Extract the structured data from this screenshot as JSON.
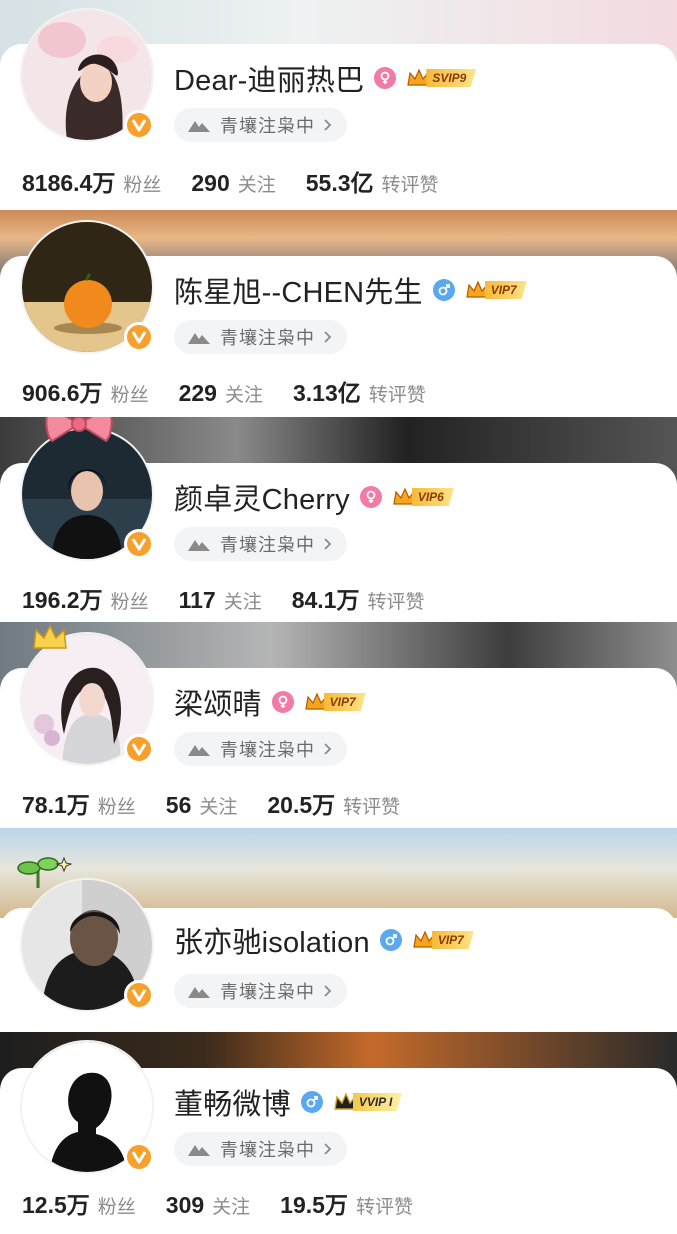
{
  "profiles": [
    {
      "name": "Dear-迪丽热巴",
      "gender": "female",
      "vip_label": "SVIP9",
      "vip_style": "gold",
      "tag": "青壤注枭中",
      "avatar_icon": "woman-portrait",
      "banner_colors": [
        "#dfe6e9",
        "#f1d8de"
      ],
      "stats": {
        "fans": "8186.4万",
        "fans_label": "粉丝",
        "follow": "290",
        "follow_label": "关注",
        "likes": "55.3亿",
        "likes_label": "转评赞"
      }
    },
    {
      "name": "陈星旭--CHEN先生",
      "gender": "male",
      "vip_label": "VIP7",
      "vip_style": "gold",
      "tag": "青壤注枭中",
      "avatar_icon": "orange-fruit",
      "banner_colors": [
        "#c7784a",
        "#3c4a5e"
      ],
      "stats": {
        "fans": "906.6万",
        "fans_label": "粉丝",
        "follow": "229",
        "follow_label": "关注",
        "likes": "3.13亿",
        "likes_label": "转评赞"
      }
    },
    {
      "name": "颜卓灵Cherry",
      "gender": "female",
      "vip_label": "VIP6",
      "vip_style": "gold",
      "tag": "青壤注枭中",
      "avatar_icon": "woman-portrait-bow",
      "banner_colors": [
        "#2a2a2a",
        "#6d6d6d"
      ],
      "stats": {
        "fans": "196.2万",
        "fans_label": "粉丝",
        "follow": "117",
        "follow_label": "关注",
        "likes": "84.1万",
        "likes_label": "转评赞"
      }
    },
    {
      "name": "梁颂晴",
      "gender": "female",
      "vip_label": "VIP7",
      "vip_style": "gold",
      "tag": "青壤注枭中",
      "avatar_icon": "illustrated-woman",
      "banner_colors": [
        "#8d8d8d",
        "#3a3a3a"
      ],
      "stats": {
        "fans": "78.1万",
        "fans_label": "粉丝",
        "follow": "56",
        "follow_label": "关注",
        "likes": "20.5万",
        "likes_label": "转评赞"
      }
    },
    {
      "name": "张亦驰isolation",
      "gender": "male",
      "vip_label": "VIP7",
      "vip_style": "gold",
      "tag": "青壤注枭中",
      "avatar_icon": "man-portrait",
      "banner_colors": [
        "#b9d3e6",
        "#d8c19a"
      ],
      "stats": null
    },
    {
      "name": "董畅微博",
      "gender": "male",
      "vip_label": "VVIP I",
      "vip_style": "black",
      "tag": "青壤注枭中",
      "avatar_icon": "silhouette-portrait",
      "banner_colors": [
        "#2b2b2b",
        "#c46a2a"
      ],
      "stats": {
        "fans": "12.5万",
        "fans_label": "粉丝",
        "follow": "309",
        "follow_label": "关注",
        "likes": "19.5万",
        "likes_label": "转评赞"
      }
    }
  ]
}
